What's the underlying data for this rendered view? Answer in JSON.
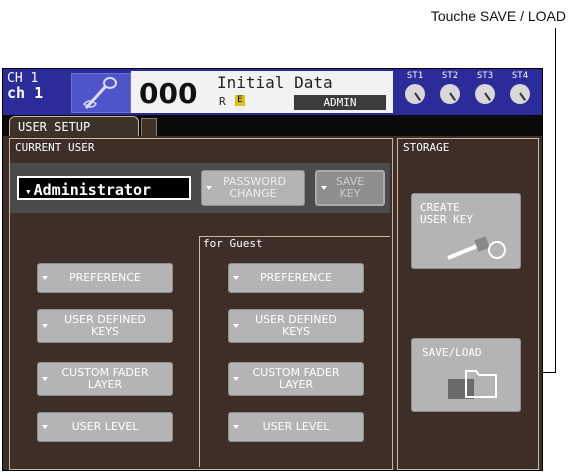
{
  "callout": {
    "text": "Touche SAVE / LOAD"
  },
  "header": {
    "ch_line1": "CH 1",
    "ch_line2": "ch 1",
    "scene_number": "000",
    "scene_title": "Initial Data",
    "scene_r": "R",
    "scene_e": "E",
    "user_level": "ADMIN",
    "st_knobs": [
      "ST1",
      "ST2",
      "ST3",
      "ST4"
    ]
  },
  "tabs": {
    "active": "USER SETUP"
  },
  "current_user": {
    "label": "CURRENT USER",
    "selected": "Administrator",
    "password_change": "PASSWORD CHANGE",
    "save_key": "SAVE KEY"
  },
  "admin_column": {
    "preference": "PREFERENCE",
    "user_defined_keys": "USER DEFINED KEYS",
    "custom_fader_layer": "CUSTOM FADER LAYER",
    "user_level": "USER LEVEL"
  },
  "guest_column": {
    "label": "for Guest",
    "preference": "PREFERENCE",
    "user_defined_keys": "USER DEFINED KEYS",
    "custom_fader_layer": "CUSTOM FADER LAYER",
    "user_level": "USER LEVEL"
  },
  "storage": {
    "label": "STORAGE",
    "create_user_key": "CREATE USER KEY",
    "save_load": "SAVE/LOAD"
  }
}
